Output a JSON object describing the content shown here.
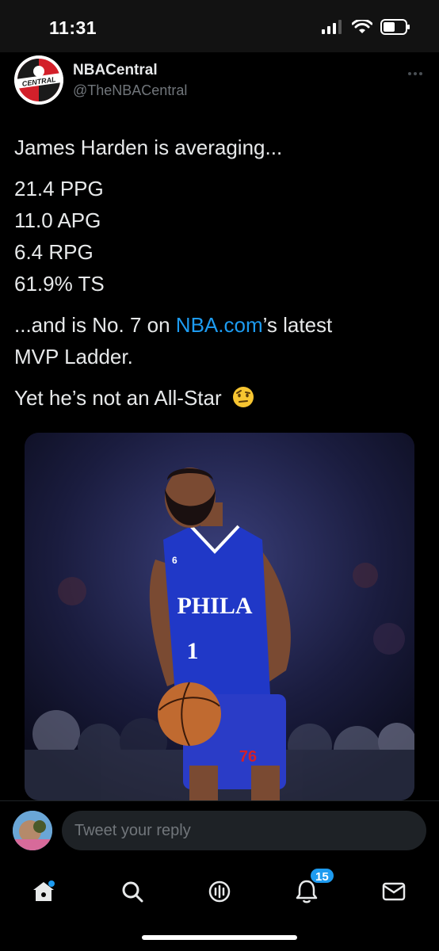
{
  "status_bar": {
    "time": "11:31"
  },
  "tweet": {
    "author": {
      "name": "NBACentral",
      "handle": "@TheNBACentral",
      "avatar_text": "CENTRAL"
    },
    "lines": {
      "l1": "James Harden is averaging...",
      "l2": "21.4 PPG",
      "l3": "11.0 APG",
      "l4": "6.4 RPG",
      "l5": "61.9% TS",
      "l6_pre": "...and is No. 7 on ",
      "l6_link": "NBA.com",
      "l6_post": "’s latest",
      "l7": "MVP Ladder.",
      "l8": "Yet he’s not an All-Star"
    },
    "emoji": "raised-eyebrow-emoji",
    "media": {
      "jersey_team": "PHILA",
      "jersey_number": "1",
      "logo_text": "76",
      "patch_number": "6"
    }
  },
  "reply": {
    "placeholder": "Tweet your reply"
  },
  "tabs": [
    {
      "icon": "home-icon"
    },
    {
      "icon": "search-icon"
    },
    {
      "icon": "spaces-icon"
    },
    {
      "icon": "notifications-icon",
      "badge": "15"
    },
    {
      "icon": "messages-icon"
    }
  ],
  "colors": {
    "accent": "#1d9bf0",
    "background": "#000000",
    "text": "#e7e9ea",
    "muted": "#71767b"
  }
}
